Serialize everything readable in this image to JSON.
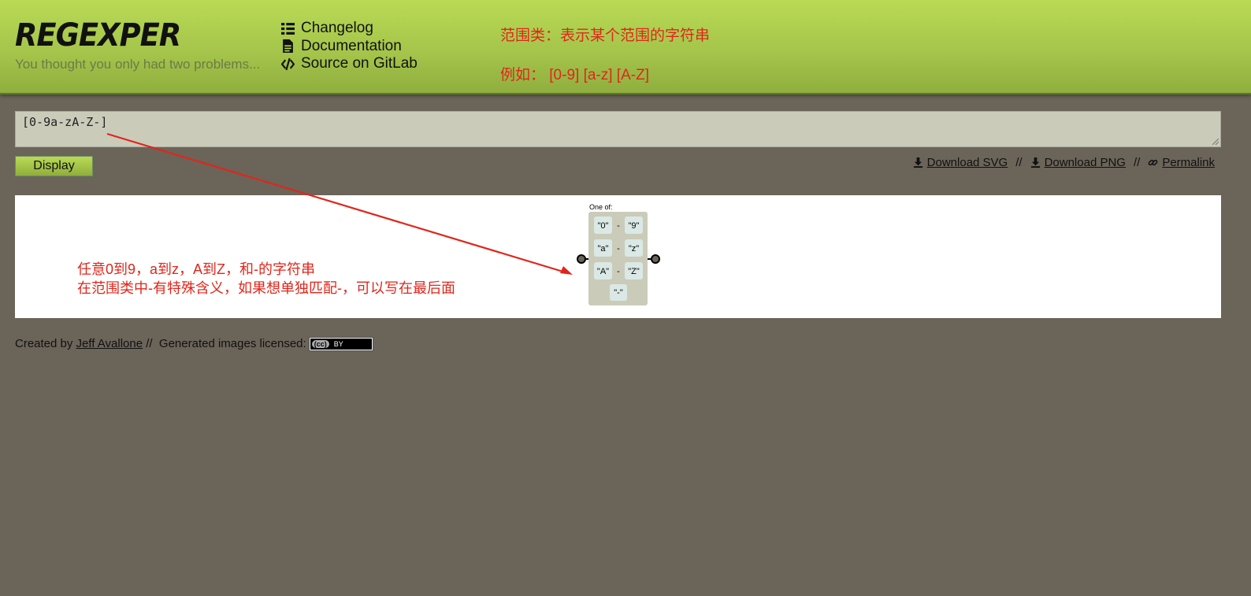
{
  "header": {
    "logo": "REGEXPER",
    "tagline": "You thought you only had two problems...",
    "nav": [
      {
        "label": "Changelog",
        "icon": "list-icon"
      },
      {
        "label": "Documentation",
        "icon": "document-icon"
      },
      {
        "label": "Source on GitLab",
        "icon": "code-icon"
      }
    ]
  },
  "annotations": {
    "title": "范围类：表示某个范围的字符串",
    "example": "例如： [0-9]  [a-z]  [A-Z]",
    "line1": "任意0到9，a到z，A到Z，和-的字符串",
    "line2": "在范围类中-有特殊含义，如果想单独匹配-，可以写在最后面",
    "color": "#e0261b"
  },
  "editor": {
    "value": "[0-9a-zA-Z-]"
  },
  "display_button": "Display",
  "downloads": {
    "svg": "Download SVG",
    "png": "Download PNG",
    "permalink": "Permalink",
    "separator": "//"
  },
  "diagram": {
    "label": "One of:",
    "ranges": [
      {
        "from": "\"0\"",
        "to": "\"9\""
      },
      {
        "from": "\"a\"",
        "to": "\"z\""
      },
      {
        "from": "\"A\"",
        "to": "\"Z\""
      }
    ],
    "dash": "-",
    "single": "\"-\""
  },
  "footer": {
    "created_by": "Created by",
    "author": "Jeff Avallone",
    "sep": "//",
    "license_text": "Generated images licensed:",
    "badge_cc": "(cc)",
    "badge_by": "BY"
  },
  "colors": {
    "accent": "#bada55",
    "background": "#6b6459",
    "editor_bg": "#cbcbba"
  }
}
